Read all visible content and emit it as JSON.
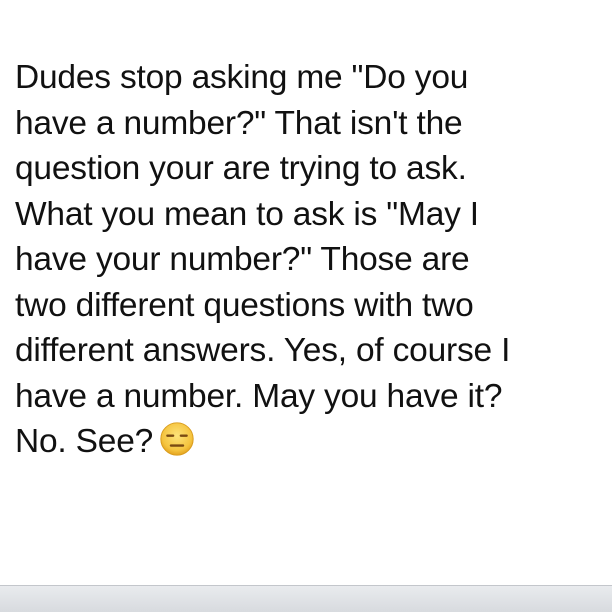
{
  "note": {
    "lines": [
      "Dudes stop asking me \"Do you",
      "have a number?\" That isn't the",
      "question your are trying to ask.",
      "What you mean to ask is \"May I",
      "have your number?\" Those are",
      "two different questions with two",
      "different answers. Yes, of course I",
      "have a number. May you have it?",
      "No. See?"
    ],
    "emoji": "expressionless-face"
  },
  "colors": {
    "text": "#111111",
    "background": "#ffffff",
    "bottom_bar": "#dde0e4",
    "emoji_face": "#f5c43f"
  }
}
